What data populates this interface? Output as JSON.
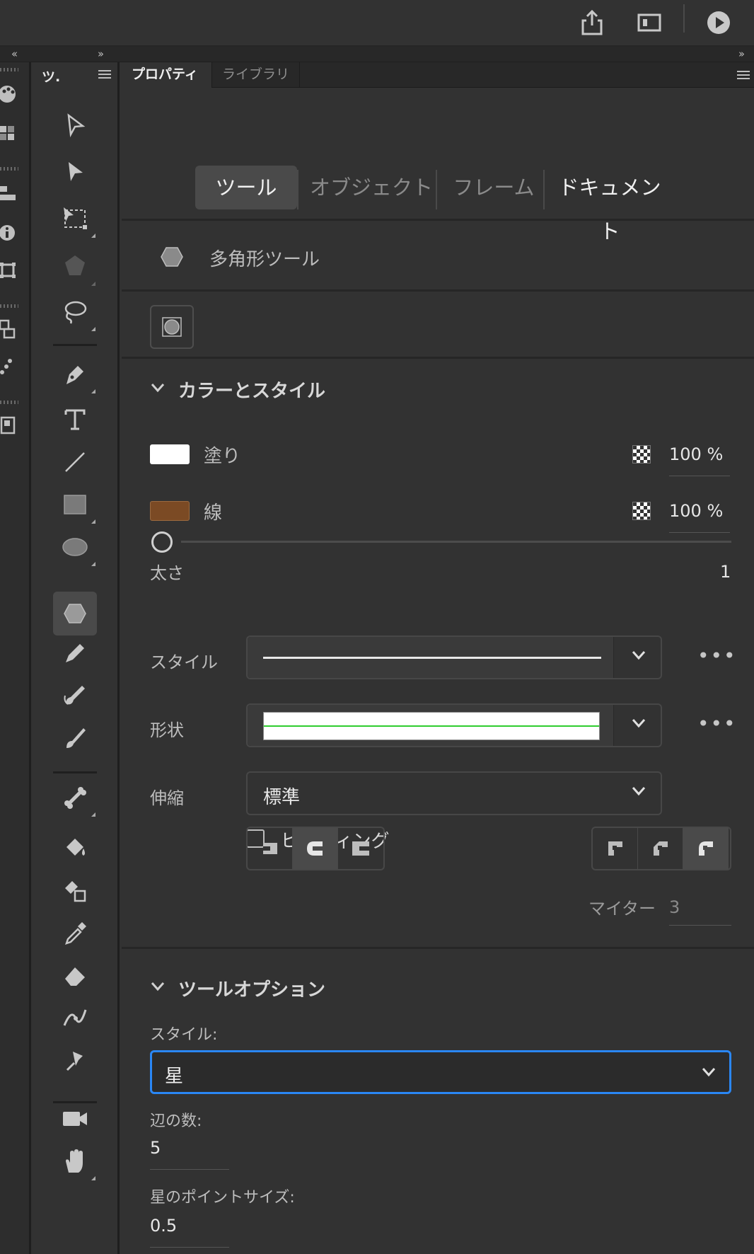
{
  "panel_tabs": {
    "tools_short": "ツ.",
    "properties": "プロパティ",
    "library": "ライブラリ"
  },
  "segments": [
    "ツール",
    "オブジェクト",
    "フレーム",
    "ドキュメント"
  ],
  "tool_name": "多角形ツール",
  "color_style": {
    "header": "カラーとスタイル",
    "fill_label": "塗り",
    "fill_color": "#ffffff",
    "fill_opacity": "100 %",
    "stroke_label": "線",
    "stroke_color": "#7b4a24",
    "stroke_opacity": "100 %",
    "width_label": "太さ",
    "width_value": "1",
    "style_label": "スタイル",
    "shape_label": "形状",
    "scale_label": "伸縮",
    "scale_value": "標準",
    "hinting_label": "ヒンティング",
    "miter_label": "マイター",
    "miter_value": "3"
  },
  "tool_options": {
    "header": "ツールオプション",
    "style_label": "スタイル:",
    "style_value": "星",
    "sides_label": "辺の数:",
    "sides_value": "5",
    "point_size_label": "星のポイントサイズ:",
    "point_size_value": "0.5"
  },
  "colors": {
    "accent": "#2a87f5",
    "panel_bg": "#323232",
    "active_tool_bg": "#4a4a4a"
  },
  "icons": [
    "share-icon",
    "frame-icon",
    "play-icon",
    "selection-arrow-icon",
    "subselection-icon",
    "free-transform-icon",
    "3d-rotation-icon",
    "lasso-icon",
    "pen-icon",
    "text-icon",
    "line-icon",
    "rectangle-icon",
    "oval-icon",
    "polystar-icon",
    "pencil-icon",
    "fluid-brush-icon",
    "paint-brush-icon",
    "bone-icon",
    "paint-bucket-icon",
    "ink-bottle-icon",
    "eyedropper-icon",
    "eraser-icon",
    "width-tool-icon",
    "asset-warp-icon",
    "camera-icon",
    "hand-icon"
  ]
}
